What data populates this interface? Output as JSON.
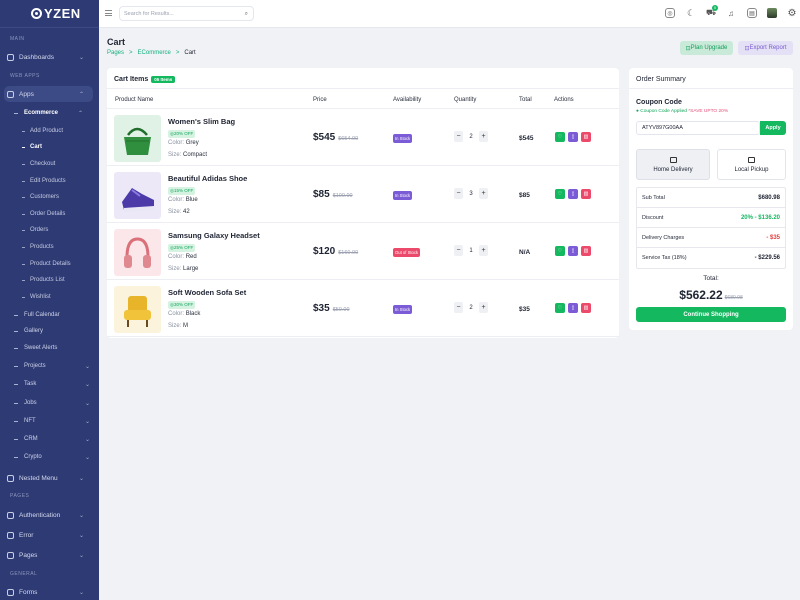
{
  "brand": {
    "name": "YZEN"
  },
  "search": {
    "placeholder": "Search for Results..."
  },
  "topbar": {
    "cart_count": "5"
  },
  "sidebar": {
    "sections": {
      "main": "MAIN",
      "web_apps": "WEB APPS",
      "pages": "PAGES",
      "general": "GENERAL"
    },
    "items": [
      {
        "label": "Dashboards"
      },
      {
        "label": "Apps"
      },
      {
        "label": "Ecommerce"
      },
      {
        "label": "Full Calendar"
      },
      {
        "label": "Gallery"
      },
      {
        "label": "Sweet Alerts"
      },
      {
        "label": "Projects"
      },
      {
        "label": "Task"
      },
      {
        "label": "Jobs"
      },
      {
        "label": "NFT"
      },
      {
        "label": "CRM"
      },
      {
        "label": "Crypto"
      },
      {
        "label": "Nested Menu"
      },
      {
        "label": "Authentication"
      },
      {
        "label": "Error"
      },
      {
        "label": "Pages"
      },
      {
        "label": "Forms"
      }
    ],
    "ecommerce_sub": [
      "Add Product",
      "Cart",
      "Checkout",
      "Edit Products",
      "Customers",
      "Order Details",
      "Orders",
      "Products",
      "Product Details",
      "Products List",
      "Wishlist"
    ]
  },
  "page": {
    "title": "Cart",
    "breadcrumb": [
      "Pages",
      "ECommerce",
      "Cart"
    ],
    "plan_upgrade": "Plan Upgrade",
    "export_report": "Export Report"
  },
  "cart": {
    "title": "Cart Items",
    "count": "05 Items",
    "headers": [
      "Product Name",
      "Price",
      "Availability",
      "Quantity",
      "Total",
      "Actions"
    ],
    "color_label": "Color:",
    "size_label": "Size:",
    "rows": [
      {
        "name": "Women's Slim Bag",
        "discount": "20% OFF",
        "color": "Grey",
        "size": "Compact",
        "price": "$545",
        "old_price": "$654.00",
        "availability": "In Stock",
        "qty": "2",
        "total": "$545",
        "avail_color": "#7c5bd6",
        "thumb_bg": "#dff2e5",
        "icon": "bag-thumbnail"
      },
      {
        "name": "Beautiful Adidas Shoe",
        "discount": "15% OFF",
        "color": "Blue",
        "size": "42",
        "price": "$85",
        "old_price": "$100.00",
        "availability": "In Stock",
        "qty": "3",
        "total": "$85",
        "avail_color": "#7c5bd6",
        "thumb_bg": "#ece8f7",
        "icon": "shoe-thumbnail"
      },
      {
        "name": "Samsung Galaxy Headset",
        "discount": "25% OFF",
        "color": "Red",
        "size": "Large",
        "price": "$120",
        "old_price": "$160.00",
        "availability": "Out of Stock",
        "qty": "1",
        "total": "N/A",
        "avail_color": "#ec4a6b",
        "thumb_bg": "#fbe7e9",
        "icon": "headset-thumbnail"
      },
      {
        "name": "Soft Wooden Sofa Set",
        "discount": "30% OFF",
        "color": "Black",
        "size": "M",
        "price": "$35",
        "old_price": "$50.00",
        "availability": "In Stock",
        "qty": "2",
        "total": "$35",
        "avail_color": "#7c5bd6",
        "thumb_bg": "#fcf3dd",
        "icon": "sofa-thumbnail"
      }
    ]
  },
  "summary": {
    "title": "Order Summary",
    "coupon_label": "Coupon Code",
    "coupon_applied": "Coupon Code Applied",
    "coupon_save": "*SAVE UPTO 20%",
    "coupon_value": "ATYV897G00AA",
    "apply": "Apply",
    "home_delivery": "Home Delivery",
    "local_pickup": "Local Pickup",
    "rows": [
      {
        "label": "Sub Total",
        "value": "$680.98"
      },
      {
        "label": "Discount",
        "value": "20% - $136.20"
      },
      {
        "label": "Delivery Charges",
        "value": "- $35"
      },
      {
        "label": "Service Tax (18%)",
        "value": "- $229.56"
      }
    ],
    "total_label": "Total:",
    "total_value": "$562.22",
    "total_old": "$680.98",
    "continue": "Continue Shopping"
  },
  "colors": {
    "accent_green": "#13b85f",
    "sidebar_bg": "#2d3a73",
    "purple": "#7c5bd6",
    "red": "#ec4a6b"
  }
}
